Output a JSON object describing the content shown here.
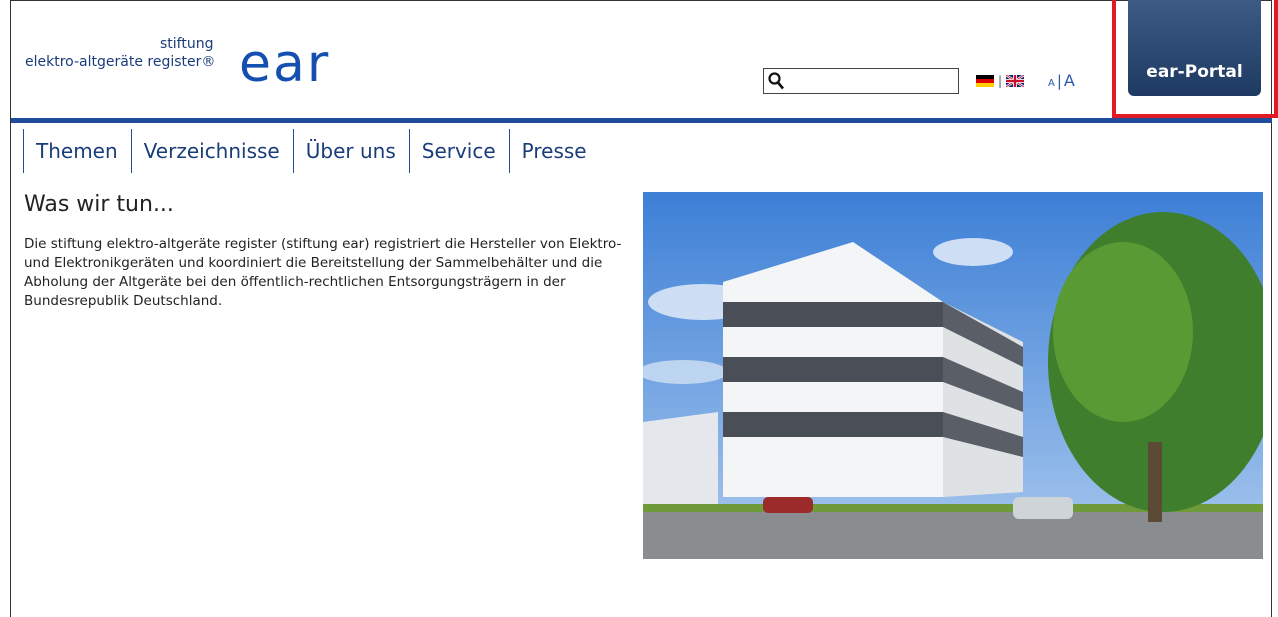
{
  "logo": {
    "line1": "stiftung",
    "line2": "elektro-altgeräte register®",
    "mark": "ear"
  },
  "search": {
    "placeholder": "",
    "value": "",
    "icon": "search-icon"
  },
  "languages": {
    "de": "german-flag-icon",
    "en": "uk-flag-icon",
    "separator": "|"
  },
  "font_size": {
    "small": "A",
    "separator": "|",
    "large": "A"
  },
  "portal_button": {
    "label": "ear-Portal"
  },
  "nav": {
    "items": [
      "Themen",
      "Verzeichnisse",
      "Über uns",
      "Service",
      "Presse"
    ]
  },
  "main": {
    "heading": "Was wir tun...",
    "body": "Die stiftung elektro-altgeräte register (stiftung ear) registriert die Hersteller von Elektro- und Elektronikgeräten und koordiniert die Bereitstellung der Sammelbehälter und die Abholung der Altgeräte bei den öffentlich-rechtlichen Entsorgungsträgern in der Bundesrepublik Deutschland."
  },
  "colors": {
    "brand_blue": "#1f4c9b",
    "portal_bg": "#2d4a72",
    "highlight": "#e01b24"
  }
}
